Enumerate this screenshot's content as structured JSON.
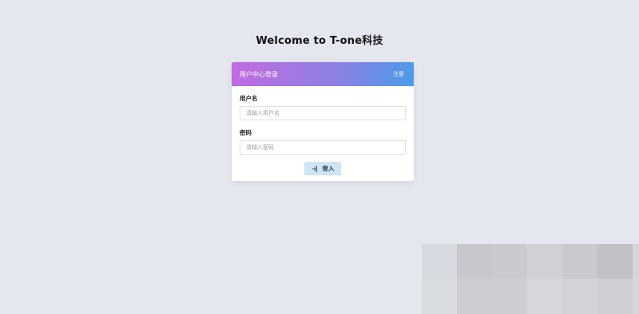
{
  "page": {
    "title": "Welcome to T-one科技"
  },
  "card": {
    "header_title": "用户中心登录",
    "register_link": "注册",
    "username": {
      "label": "用户名",
      "placeholder": "请输入用户名",
      "value": ""
    },
    "password": {
      "label": "密码",
      "placeholder": "请输入密码",
      "value": ""
    },
    "login_button": "登入",
    "login_icon": "login-icon"
  },
  "colors": {
    "background": "#e4e7ee",
    "header_gradient_start": "#c26be0",
    "header_gradient_end": "#4a9be9",
    "button_bg": "#cfe4f5"
  }
}
